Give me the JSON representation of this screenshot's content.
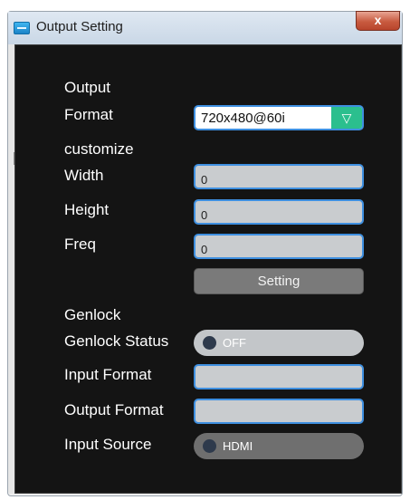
{
  "window": {
    "title": "Output Setting",
    "close_symbol": "x"
  },
  "form": {
    "output_format_label_line1": "Output",
    "output_format_label_line2": "Format",
    "output_format_value": "720x480@60i",
    "dropdown_arrow": "▽",
    "customize_label": "customize",
    "width_label": "Width",
    "width_value": "0",
    "height_label": "Height",
    "height_value": "0",
    "freq_label": "Freq",
    "freq_value": "0",
    "setting_button": "Setting",
    "genlock_label": "Genlock",
    "genlock_status_label": "Genlock Status",
    "genlock_status_value": "OFF",
    "input_format_label": "Input Format",
    "input_format_value": "",
    "output_format2_label": "Output Format",
    "output_format2_value": "",
    "input_source_label": "Input Source",
    "input_source_value": "HDMI"
  },
  "icons": {
    "app": "app-icon",
    "close": "close-icon",
    "dropdown": "triangle-down-icon"
  },
  "colors": {
    "panel_bg": "#141414",
    "field_border": "#3e8fe0",
    "dropdown_accent": "#2bbf8e",
    "close_button": "#c85a3f"
  }
}
